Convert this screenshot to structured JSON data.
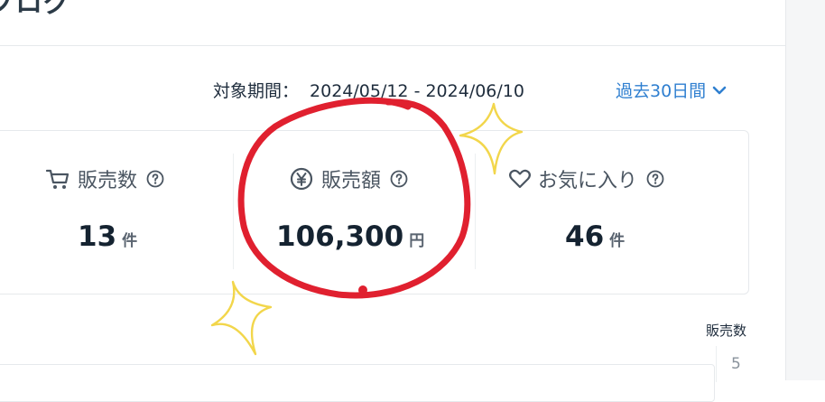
{
  "page": {
    "title": "ブログ"
  },
  "period": {
    "label": "対象期間：",
    "range": "2024/05/12 - 2024/06/10",
    "selector": "過去30日間"
  },
  "stats": [
    {
      "label": "販売数",
      "value": "13",
      "unit": "件",
      "icon": "cart-icon"
    },
    {
      "label": "販売額",
      "value": "106,300",
      "unit": "円",
      "icon": "yen-icon"
    },
    {
      "label": "お気に入り",
      "value": "46",
      "unit": "件",
      "icon": "heart-icon"
    }
  ],
  "chart": {
    "label": "販売数",
    "tick": "5"
  },
  "annotations": {
    "circle_color": "#e0202f",
    "sparkle_color": "#f2d64b"
  }
}
